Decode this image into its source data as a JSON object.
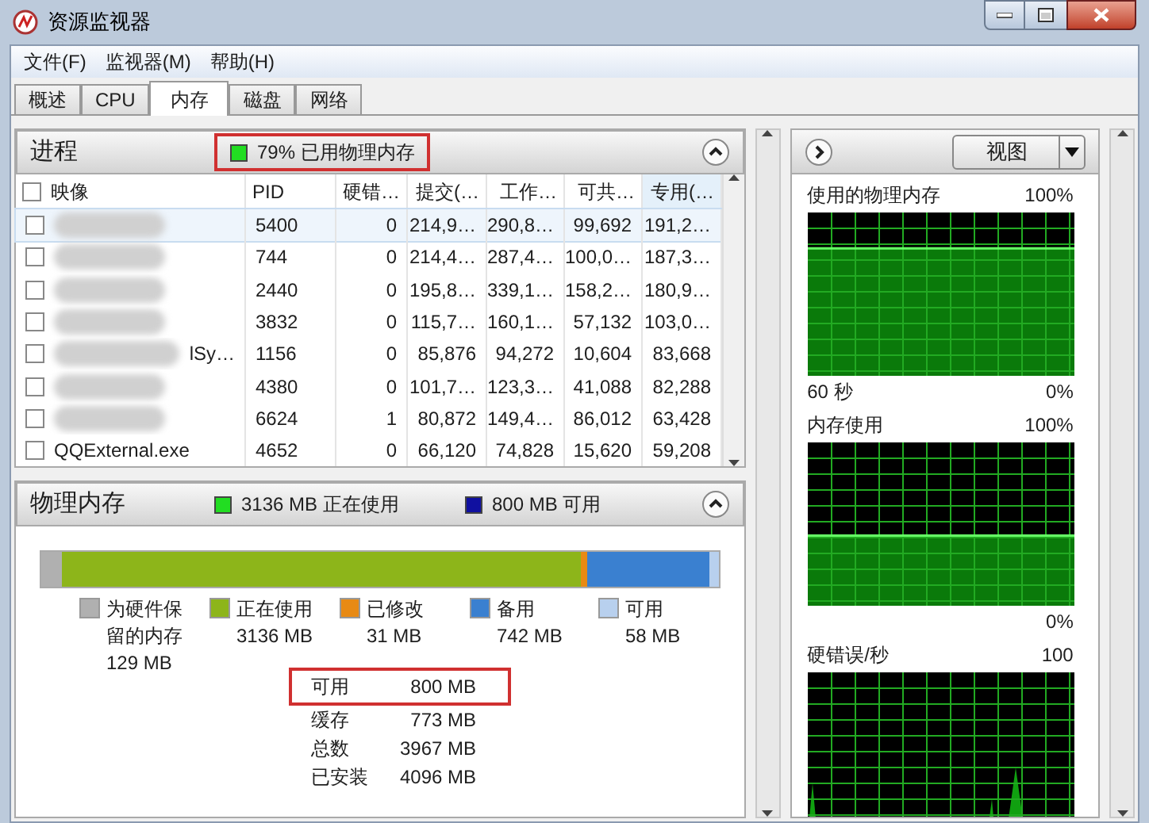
{
  "window": {
    "title": "资源监视器"
  },
  "menu": [
    "文件(F)",
    "监视器(M)",
    "帮助(H)"
  ],
  "tabs": [
    {
      "label": "概述",
      "selected": false
    },
    {
      "label": "CPU",
      "selected": false
    },
    {
      "label": "内存",
      "selected": true
    },
    {
      "label": "磁盘",
      "selected": false
    },
    {
      "label": "网络",
      "selected": false
    }
  ],
  "processes": {
    "title": "进程",
    "summary": "79% 已用物理内存",
    "expanded": true,
    "all_checked": false,
    "columns": [
      "映像",
      "PID",
      "硬错…",
      "提交(…",
      "工作…",
      "可共…",
      "专用(…"
    ],
    "rows": [
      {
        "redacted": true,
        "selected": true,
        "checked": false,
        "cells": [
          "",
          "5400",
          "0",
          "214,9…",
          "290,8…",
          "99,692",
          "191,2…"
        ]
      },
      {
        "redacted": true,
        "selected": false,
        "checked": false,
        "cells": [
          "",
          "744",
          "0",
          "214,4…",
          "287,4…",
          "100,0…",
          "187,3…"
        ]
      },
      {
        "redacted": true,
        "selected": false,
        "checked": false,
        "cells": [
          "",
          "2440",
          "0",
          "195,8…",
          "339,1…",
          "158,2…",
          "180,9…"
        ]
      },
      {
        "redacted": true,
        "selected": false,
        "checked": false,
        "cells": [
          "",
          "3832",
          "0",
          "115,7…",
          "160,1…",
          "57,132",
          "103,0…"
        ]
      },
      {
        "redacted": true,
        "selected": false,
        "checked": false,
        "cells": [
          "lSy…",
          "1156",
          "0",
          "85,876",
          "94,272",
          "10,604",
          "83,668"
        ]
      },
      {
        "redacted": true,
        "selected": false,
        "checked": false,
        "cells": [
          "",
          "4380",
          "0",
          "101,7…",
          "123,3…",
          "41,088",
          "82,288"
        ]
      },
      {
        "redacted": true,
        "selected": false,
        "checked": false,
        "cells": [
          "",
          "6624",
          "1",
          "80,872",
          "149,4…",
          "86,012",
          "63,428"
        ]
      },
      {
        "redacted": false,
        "selected": false,
        "checked": false,
        "cells": [
          "QQExternal.exe",
          "4652",
          "0",
          "66,120",
          "74,828",
          "15,620",
          "59,208"
        ]
      }
    ]
  },
  "physical_memory": {
    "title": "物理内存",
    "expanded": true,
    "badges": [
      {
        "text": "3136 MB 正在使用",
        "color": "#22dd22"
      },
      {
        "text": "800 MB 可用",
        "color": "#1010a0"
      }
    ],
    "legend": [
      {
        "label": "为硬件保留的内存",
        "value": "129 MB",
        "color": "#b0b0b0"
      },
      {
        "label": "正在使用",
        "value": "3136 MB",
        "color": "#8db51a"
      },
      {
        "label": "已修改",
        "value": "31 MB",
        "color": "#e88a14"
      },
      {
        "label": "备用",
        "value": "742 MB",
        "color": "#3a80d0"
      },
      {
        "label": "可用",
        "value": "58 MB",
        "color": "#b8d0ee"
      }
    ],
    "totals": [
      {
        "label": "可用",
        "value": "800 MB",
        "highlighted": true
      },
      {
        "label": "缓存",
        "value": "773 MB",
        "highlighted": false
      },
      {
        "label": "总数",
        "value": "3967 MB",
        "highlighted": false
      },
      {
        "label": "已安装",
        "value": "4096 MB",
        "highlighted": false
      }
    ]
  },
  "graphs_panel": {
    "view_button": "视图",
    "graphs": [
      {
        "title": "使用的物理内存",
        "max": "100%",
        "time": "60 秒",
        "min": "0%",
        "level": 0.78
      },
      {
        "title": "内存使用",
        "max": "100%",
        "min": "0%",
        "level": 0.43
      },
      {
        "title": "硬错误/秒",
        "max": "100"
      }
    ]
  }
}
